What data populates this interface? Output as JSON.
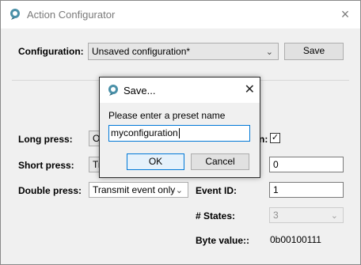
{
  "window": {
    "title": "Action Configurator",
    "close_icon": "×"
  },
  "configuration": {
    "label": "Configuration:",
    "value": "Unsaved configuration*",
    "save_label": "Save"
  },
  "fields": {
    "long_press_label": "Long press:",
    "long_press_value": "Or",
    "short_press_label": "Short press:",
    "short_press_value": "Tr",
    "double_press_label": "Double press:",
    "double_press_value": "Transmit event only",
    "right_label_1_tail": "n:",
    "right_checkbox_checked": "✓",
    "right_value_2": "0",
    "event_id_label": "Event ID:",
    "event_id_value": "1",
    "states_label": "# States:",
    "states_value": "3",
    "byte_value_label": "Byte value::",
    "byte_value": "0b00100111"
  },
  "dialog": {
    "title": "Save...",
    "prompt": "Please enter a preset name",
    "input_value": "myconfiguration",
    "ok_label": "OK",
    "cancel_label": "Cancel",
    "close_icon": "✕"
  },
  "icons": {
    "app": "app-logo-icon",
    "chevron": "chevron-down-icon"
  },
  "colors": {
    "focus_border": "#0078d7",
    "titlebar": "#ffffff",
    "window_bg": "#f0f0f0"
  }
}
